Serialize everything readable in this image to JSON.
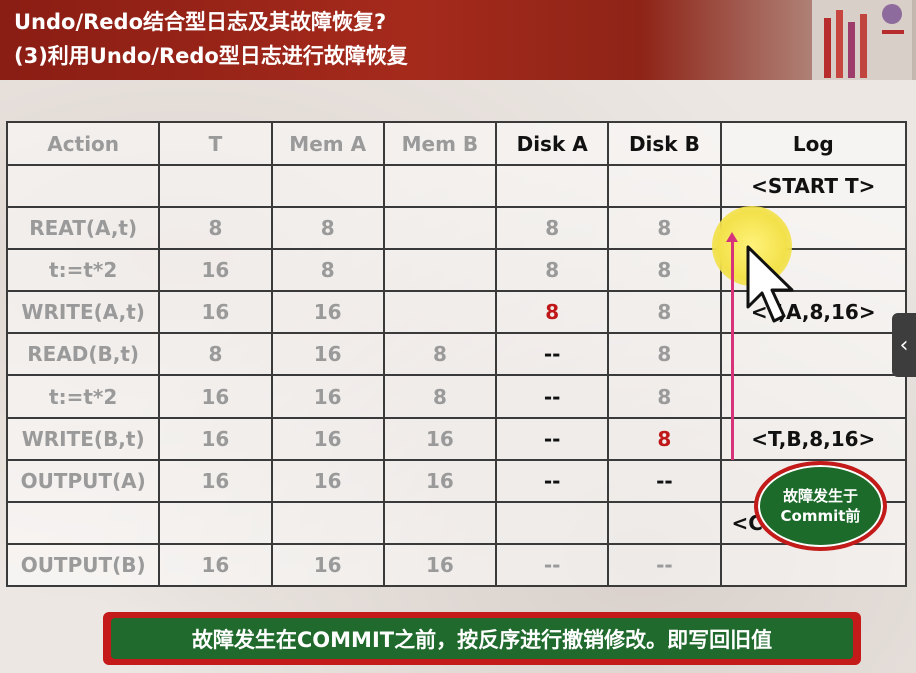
{
  "slide": {
    "title_line1": "Undo/Redo结合型日志及其故障恢复?",
    "title_line2": "(3)利用Undo/Redo型日志进行故障恢复"
  },
  "table": {
    "headers": [
      "Action",
      "T",
      "Mem A",
      "Mem B",
      "Disk A",
      "Disk B",
      "Log"
    ],
    "rows": [
      [
        "",
        "",
        "",
        "",
        "",
        "",
        "<START T>"
      ],
      [
        "REAT(A,t)",
        "8",
        "8",
        "",
        "8",
        "8",
        ""
      ],
      [
        "t:=t*2",
        "16",
        "8",
        "",
        "8",
        "8",
        ""
      ],
      [
        "WRITE(A,t)",
        "16",
        "16",
        "",
        "8",
        "8",
        "<T,A,8,16>"
      ],
      [
        "READ(B,t)",
        "8",
        "16",
        "8",
        "--",
        "8",
        ""
      ],
      [
        "t:=t*2",
        "16",
        "16",
        "8",
        "--",
        "8",
        ""
      ],
      [
        "WRITE(B,t)",
        "16",
        "16",
        "16",
        "--",
        "8",
        "<T,B,8,16>"
      ],
      [
        "OUTPUT(A)",
        "16",
        "16",
        "16",
        "--",
        "--",
        ""
      ],
      [
        "",
        "",
        "",
        "",
        "",
        "",
        "<COMMIT T>"
      ],
      [
        "OUTPUT(B)",
        "16",
        "16",
        "16",
        "--",
        "--",
        ""
      ]
    ],
    "visible_log": {
      "row4": "<T,A,8,16>",
      "row9": "<C"
    }
  },
  "callout": {
    "line1": "故障发生于",
    "line2": "Commit前"
  },
  "banner": {
    "text": "故障发生在COMMIT之前，按反序进行撤销修改。即写回旧值"
  },
  "side_tab": {
    "glyph": "‹"
  },
  "colors": {
    "header_bg": "#a52a1c",
    "highlight_red": "#c01818",
    "banner_green": "#1f6a2c",
    "banner_border": "#c41a1a",
    "pink_marker": "#d6337a"
  }
}
